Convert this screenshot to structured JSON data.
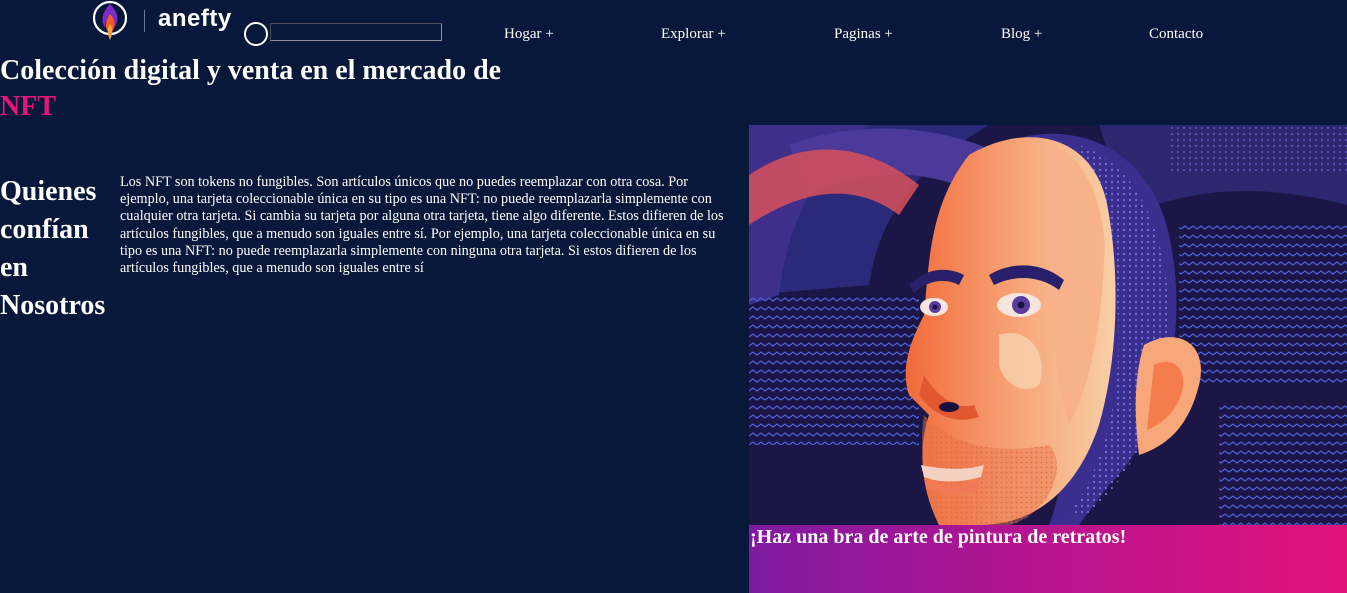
{
  "header": {
    "logo_text": "anefty",
    "search": {
      "value": "",
      "placeholder": ""
    },
    "nav": [
      {
        "label": "Hogar +"
      },
      {
        "label": "Explorar +"
      },
      {
        "label": "Paginas +"
      },
      {
        "label": "Blog +"
      },
      {
        "label": "Contacto"
      }
    ]
  },
  "hero": {
    "title_line1": "Colección digital y venta en el mercado de",
    "title_accent": "NFT"
  },
  "about": {
    "heading": "Quienes confían en Nosotros",
    "body": "Los NFT son tokens no fungibles. Son artículos únicos que no puedes reemplazar con otra cosa. Por ejemplo, una tarjeta coleccionable única en su tipo es una NFT: no puede reemplazarla simplemente con cualquier otra tarjeta. Si cambia su tarjeta por alguna otra tarjeta, tiene algo diferente. Estos difieren de los artículos fungibles, que a menudo son iguales entre sí. Por ejemplo, una tarjeta coleccionable única en su tipo es una NFT: no puede reemplazarla simplemente con ninguna otra tarjeta. Si estos difieren de los artículos fungibles, que a menudo son iguales entre sí"
  },
  "art": {
    "caption": "¡Haz una bra de arte de pintura de retratos!"
  },
  "colors": {
    "background": "#08183a",
    "accent": "#e5157a",
    "banner_start": "#7d1aa0",
    "banner_end": "#e0127a"
  },
  "icons": {
    "logo": "flame-logo-icon",
    "search": "search-icon"
  }
}
